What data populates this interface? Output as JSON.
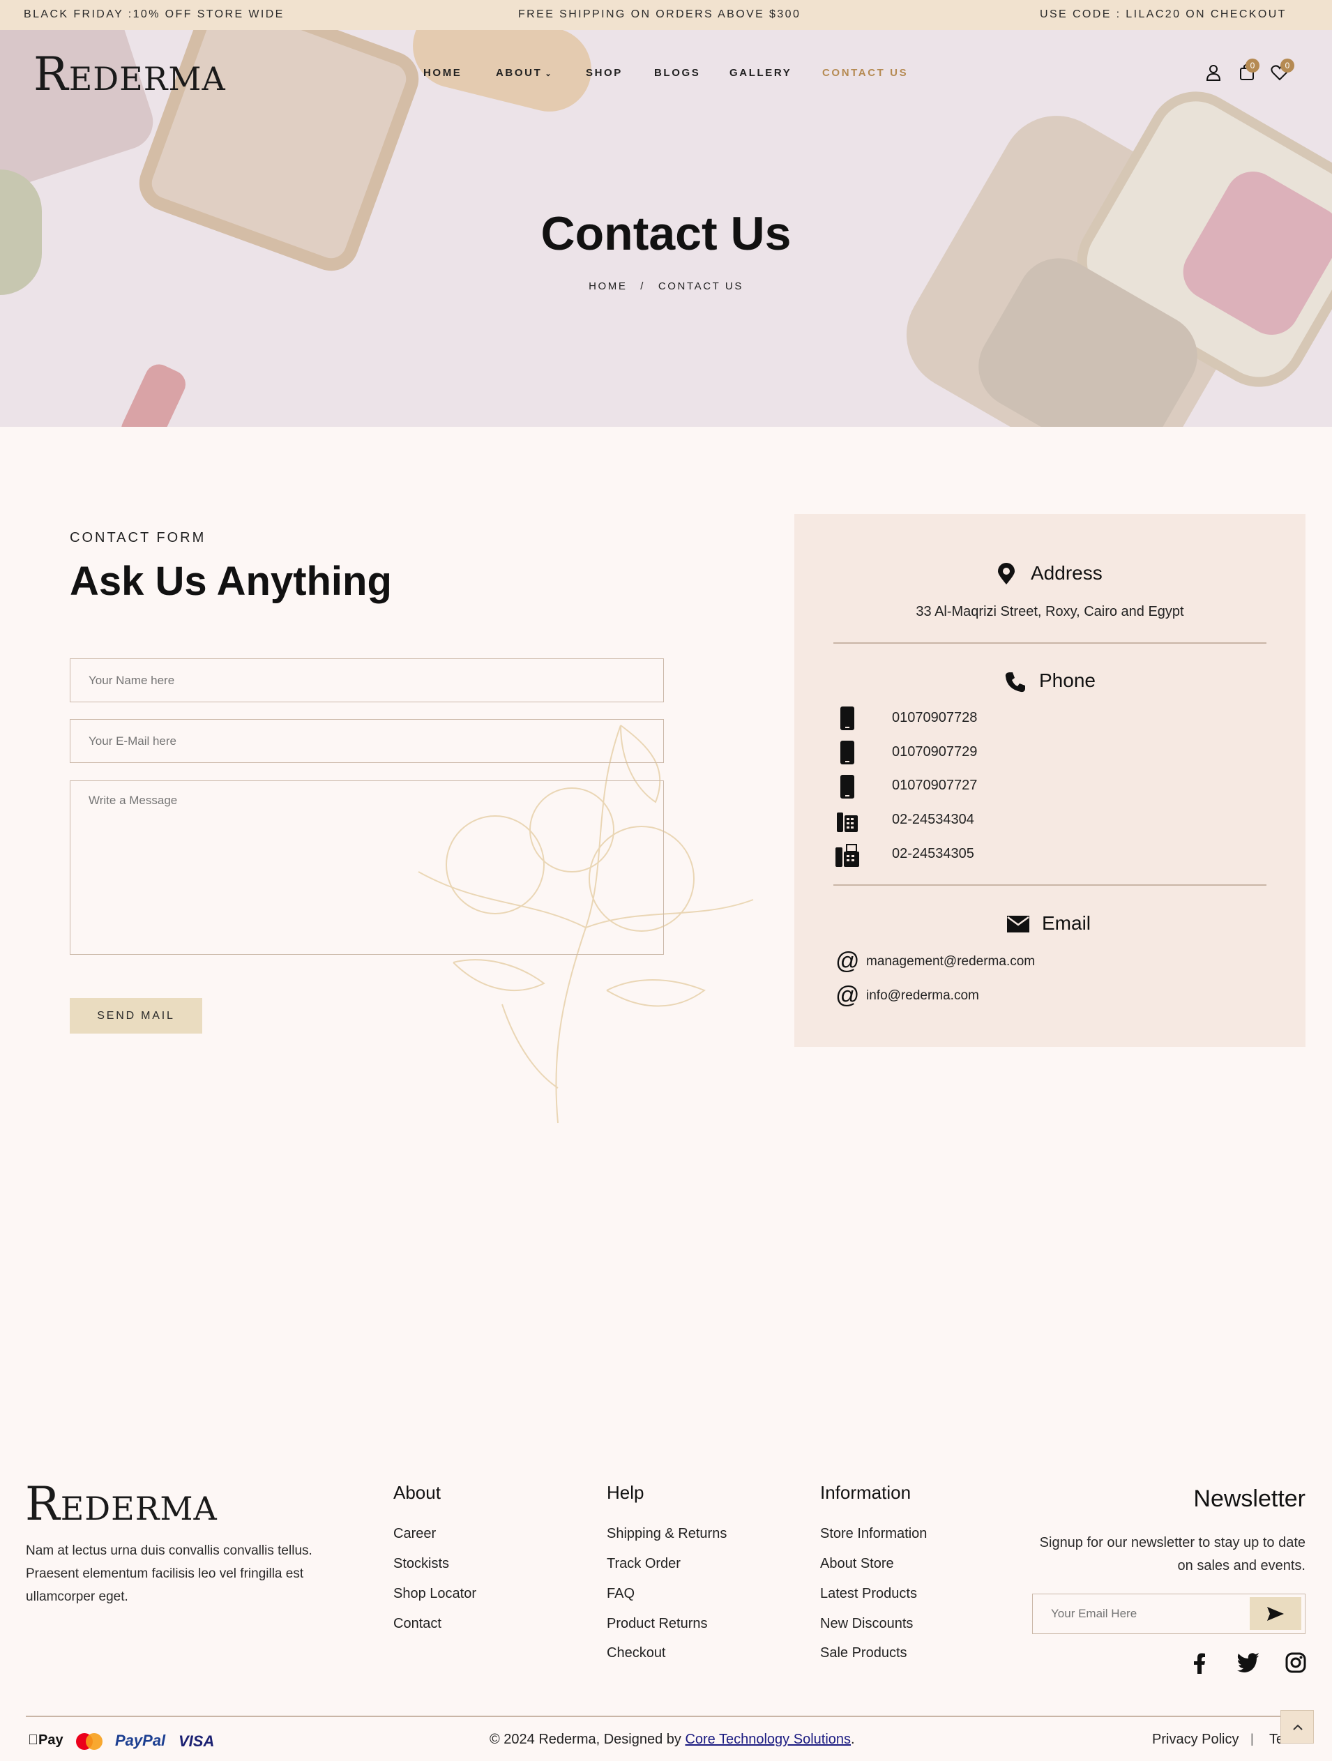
{
  "topbar": {
    "left": "BLACK FRIDAY :10% OFF STORE WIDE",
    "center": "FREE SHIPPING ON ORDERS ABOVE $300",
    "right": "USE CODE : LILAC20 ON CHECKOUT"
  },
  "brand": {
    "first": "R",
    "rest": "EDERMA"
  },
  "nav": {
    "home": "HOME",
    "about": "ABOUT",
    "shop": "SHOP",
    "blogs": "BLOGS",
    "gallery": "GALLERY",
    "contact": "CONTACT US"
  },
  "header_icons": {
    "cart_count": "0",
    "wishlist_count": "0"
  },
  "hero": {
    "title": "Contact Us",
    "crumb_home": "HOME",
    "crumb_sep": "/",
    "crumb_current": "CONTACT US"
  },
  "form": {
    "eyebrow": "CONTACT FORM",
    "heading": "Ask Us Anything",
    "name_placeholder": "Your Name here",
    "email_placeholder": "Your E-Mail here",
    "message_placeholder": "Write a Message",
    "submit": "SEND MAIL"
  },
  "info": {
    "address_title": "Address",
    "address": "33 Al-Maqrizi Street, Roxy, Cairo and Egypt",
    "phone_title": "Phone",
    "phones": [
      "01070907728",
      "01070907729",
      "01070907727",
      "02-24534304",
      "02-24534305"
    ],
    "email_title": "Email",
    "emails": [
      "management@rederma.com",
      "info@rederma.com"
    ]
  },
  "footer": {
    "about_text": "Nam at lectus urna duis convallis convallis tellus. Praesent elementum facilisis leo vel fringilla est ullamcorper eget.",
    "col_about": {
      "title": "About",
      "links": [
        "Career",
        "Stockists",
        "Shop Locator",
        "Contact"
      ]
    },
    "col_help": {
      "title": "Help",
      "links": [
        "Shipping & Returns",
        "Track Order",
        "FAQ",
        "Product Returns",
        "Checkout"
      ]
    },
    "col_info": {
      "title": "Information",
      "links": [
        "Store Information",
        "About Store",
        "Latest Products",
        "New Discounts",
        "Sale Products"
      ]
    },
    "newsletter": {
      "title": "Newsletter",
      "text": "Signup for our newsletter to stay up to date on sales and events.",
      "placeholder": "Your Email Here"
    },
    "payments": {
      "apple": "Pay",
      "paypal": "PayPal",
      "visa": "VISA"
    },
    "copyright_prefix": "© 2024 Rederma, Designed by ",
    "copyright_link": "Core Technology Solutions",
    "copyright_suffix": ".",
    "privacy": "Privacy Policy",
    "sep": "|",
    "terms": "Terms"
  },
  "colors": {
    "topbar": "#f1e2cf",
    "hero": "#ece3e8",
    "accent": "#b58a52",
    "card": "#f6e9e2",
    "button": "#eadcc0"
  }
}
